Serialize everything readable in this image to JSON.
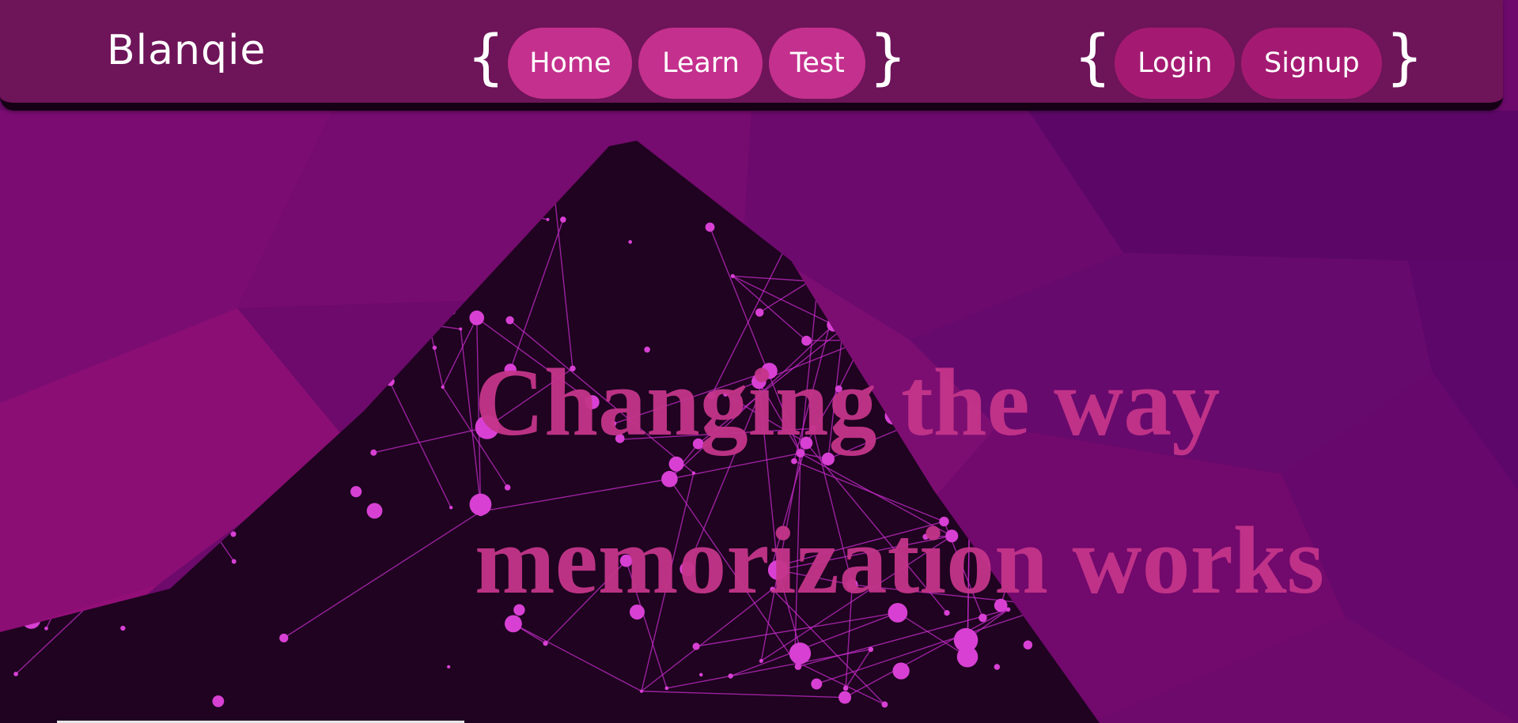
{
  "colors": {
    "background": "#6a0a6e",
    "navbar": "#6e1459",
    "nav_button": "#c4308e",
    "auth_button": "#a41a72",
    "hero_text": "#c4358a",
    "network_dark": "#1f0320",
    "network_lines": "#d238d6"
  },
  "navbar": {
    "brand": "Blanqie",
    "brace_open": "{",
    "brace_close": "}",
    "main_links": [
      "Home",
      "Learn",
      "Test"
    ],
    "auth_links": [
      "Login",
      "Signup"
    ]
  },
  "hero": {
    "line1": "Changing the way",
    "line2": "memorization works"
  }
}
